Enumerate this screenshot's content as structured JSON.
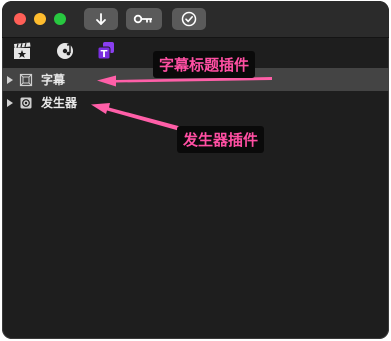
{
  "toolbar": {
    "buttons": [
      {
        "icon": "download-arrow-icon"
      },
      {
        "icon": "key-icon"
      },
      {
        "icon": "checkmark-circle-icon"
      }
    ]
  },
  "browser_tabs": [
    {
      "icon": "clapperboard-star-icon",
      "selected": false
    },
    {
      "icon": "music-note-icon",
      "selected": false
    },
    {
      "icon": "titles-t-icon",
      "selected": true,
      "color": "#8a3ff0"
    }
  ],
  "sidebar": {
    "items": [
      {
        "label": "字幕",
        "icon": "titles-frame-icon",
        "selected": true
      },
      {
        "label": "发生器",
        "icon": "generator-icon",
        "selected": false
      }
    ]
  },
  "annotations": {
    "callout_titles": "字幕标题插件",
    "callout_generators": "发生器插件",
    "color": "#ff5fa8"
  }
}
